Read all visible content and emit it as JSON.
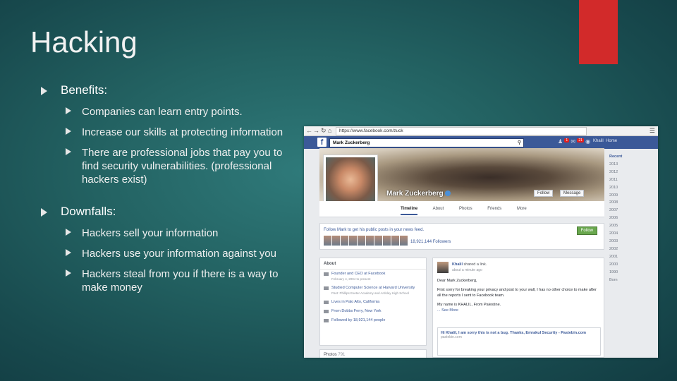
{
  "slide": {
    "title": "Hacking",
    "accent_color": "#d22a2a",
    "bullets": {
      "benefits_heading": "Benefits:",
      "benefits": [
        "Companies can learn entry points.",
        "Increase our skills at protecting information",
        "There are professional jobs that pay you to find security vulnerabilities. (professional hackers exist)"
      ],
      "downfalls_heading": "Downfalls:",
      "downfalls": [
        "Hackers sell your information",
        "Hackers use your information against you",
        "Hackers steal from you if there is a way to make money"
      ]
    }
  },
  "screenshot": {
    "url": "https://www.facebook.com/zuck",
    "search_value": "Mark Zuckerberg",
    "badges": [
      "1",
      "21"
    ],
    "nav_user": "Khalil",
    "nav_home": "Home",
    "profile_name": "Mark Zuckerberg",
    "follow_button": "Follow",
    "message_button": "Message",
    "tabs": [
      "Timeline",
      "About",
      "Photos",
      "Friends",
      "More"
    ],
    "years": [
      "Recent",
      "2013",
      "2012",
      "2011",
      "2010",
      "2009",
      "2008",
      "2007",
      "2006",
      "2005",
      "2004",
      "2003",
      "2002",
      "2001",
      "2000",
      "1990",
      "Born"
    ],
    "follow_prompt": "Follow Mark to get his public posts in your news feed.",
    "follow_green_button": "Follow",
    "followers": "18,921,144 Followers",
    "about": {
      "heading": "About",
      "items": [
        {
          "text": "Founder and CEO at Facebook",
          "sub": "February 4, 2004 to present"
        },
        {
          "text": "Studied Computer Science at Harvard University",
          "sub": "Past: Phillips Exeter Academy and Ardsley High School"
        },
        {
          "text": "Lives in Palo Alto, California",
          "sub": ""
        },
        {
          "text": "From Dobbs Ferry, New York",
          "sub": ""
        },
        {
          "text": "Followed by 18,921,144 people",
          "sub": ""
        }
      ]
    },
    "photos_label": "Photos",
    "photos_count": "791",
    "post": {
      "author": "Khalil",
      "shared": "shared a link.",
      "time": "about a minute ago",
      "greeting": "Dear Mark Zuckerberg,",
      "body": "First sorry for breaking your privacy and post to your wall, I has no other choice to make after all the reports I sent to Facebook team.",
      "signature": "My name is KHALIL, From Palestine.",
      "see_more": "... See More",
      "link_title": "Hi Khalil, I am sorry this is not a bug. Thanks, Emrakul Security - Pastebin.com",
      "link_domain": "pastebin.com"
    }
  }
}
